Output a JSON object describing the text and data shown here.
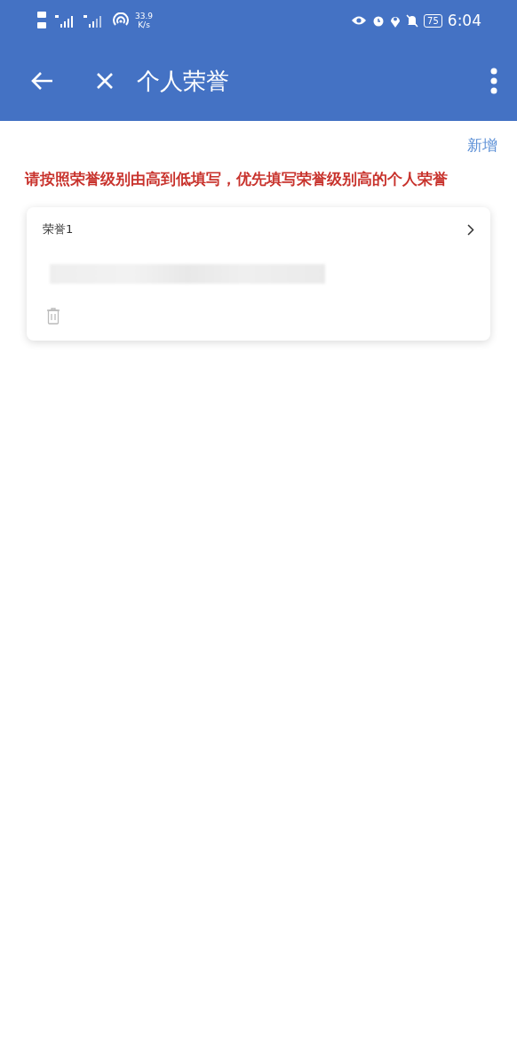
{
  "status_bar": {
    "speed_value": "33.9",
    "speed_unit": "K/s",
    "battery": "75",
    "time": "6:04"
  },
  "app_bar": {
    "title": "个人荣誉"
  },
  "add_link": "新增",
  "notice": "请按照荣誉级别由高到低填写，优先填写荣誉级别高的个人荣誉",
  "honors": [
    {
      "title": "荣誉1"
    }
  ]
}
